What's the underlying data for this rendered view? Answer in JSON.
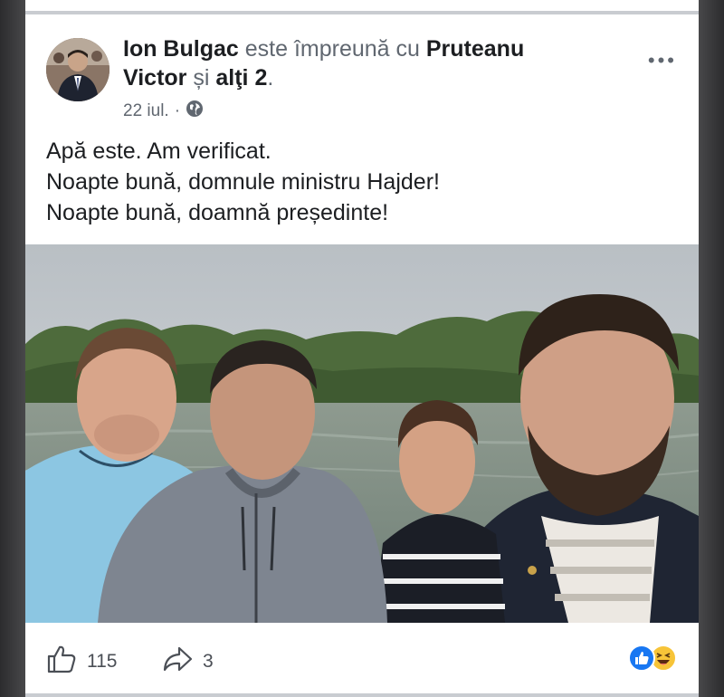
{
  "post": {
    "author": "Ion Bulgac",
    "with_text": "este împreună cu",
    "tagged_first": "Pruteanu Victor",
    "and_text": "și",
    "others": "alţi 2",
    "period": ".",
    "date": "22 iul.",
    "date_sep": "·",
    "privacy_icon": "globe-icon",
    "more_label": "•••",
    "text_lines": [
      "Apă este. Am verificat.",
      "Noapte bună, domnule ministru Hajder!",
      "Noapte bună, doamnă președinte!"
    ]
  },
  "footer": {
    "like_icon": "thumbs-up-icon",
    "like_count": "115",
    "share_icon": "share-arrow-icon",
    "share_count": "3",
    "reaction_icons": [
      "like-reaction-icon",
      "haha-reaction-icon"
    ]
  },
  "colors": {
    "facebook_blue": "#1877f2",
    "text_primary": "#1c1e21",
    "text_secondary": "#606770"
  }
}
